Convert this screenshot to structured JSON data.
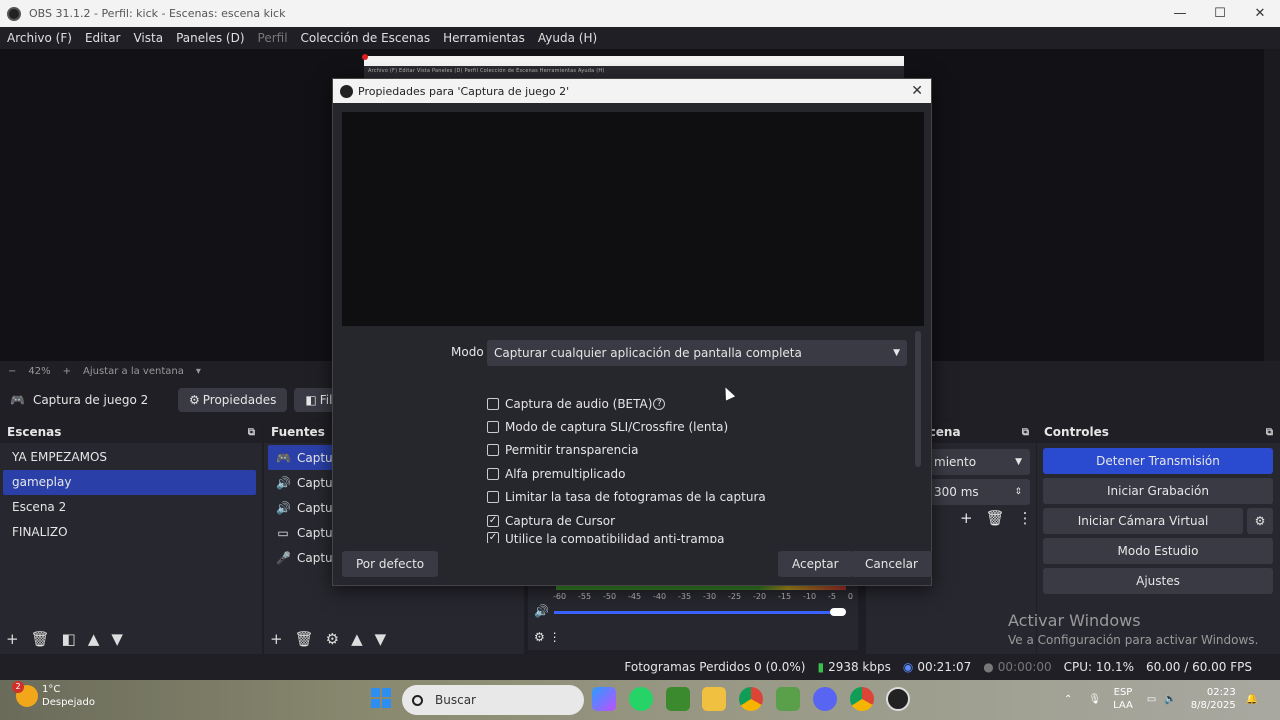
{
  "window": {
    "title": "OBS 31.1.2 - Perfil: kick - Escenas: escena kick",
    "minimize": "—",
    "maximize": "☐",
    "close": "✕"
  },
  "menu": {
    "items": [
      "Archivo (F)",
      "Editar",
      "Vista",
      "Paneles (D)",
      "Perfil",
      "Colección de Escenas",
      "Herramientas",
      "Ayuda (H)"
    ]
  },
  "preview": {
    "thumb_menu": "Archivo (F)  Editar  Vista  Paneles (D)  Perfil  Colección de Escenas  Herramientas  Ayuda (H)"
  },
  "zoom": {
    "minus": "−",
    "level": "42%",
    "plus": "+",
    "fit": "Ajustar a la ventana",
    "dropdown": "▾"
  },
  "source_toolbar": {
    "source_name": "Captura de juego 2",
    "properties_label": "Propiedades",
    "filters_label": "Filtros"
  },
  "scenes": {
    "title": "Escenas",
    "items": [
      "YA EMPEZAMOS",
      "gameplay",
      "Escena 2",
      "FINALIZO"
    ],
    "active_index": 1
  },
  "sources": {
    "title": "Fuentes",
    "items": [
      "Captura",
      "Captura",
      "Captura",
      "Captura",
      "Captura"
    ]
  },
  "transitions": {
    "title": "es de escena",
    "mode": "miento",
    "duration": "300 ms"
  },
  "controls": {
    "title": "Controles",
    "stop_stream": "Detener Transmisión",
    "start_recording": "Iniciar Grabación",
    "virtual_cam": "Iniciar Cámara Virtual",
    "studio_mode": "Modo Estudio",
    "settings": "Ajustes"
  },
  "mixer": {
    "ticks": [
      "-60",
      "-55",
      "-50",
      "-45",
      "-40",
      "-35",
      "-30",
      "-25",
      "-20",
      "-15",
      "-10",
      "-5",
      "0"
    ]
  },
  "activate": {
    "line1": "Activar Windows",
    "line2": "Ve a Configuración para activar Windows."
  },
  "status": {
    "dropped": "Fotogramas Perdidos 0 (0.0%)",
    "bitrate": "2938 kbps",
    "stream_time": "00:21:07",
    "rec_time": "00:00:00",
    "cpu": "CPU: 10.1%",
    "fps": "60.00 / 60.00 FPS"
  },
  "dialog": {
    "title": "Propiedades para 'Captura de juego 2'",
    "mode_label": "Modo",
    "mode_value": "Capturar cualquier aplicación de pantalla completa",
    "options": [
      {
        "label": "Captura de audio (BETA)",
        "checked": false,
        "help": true
      },
      {
        "label": "Modo de captura SLI/Crossfire (lenta)",
        "checked": false
      },
      {
        "label": "Permitir transparencia",
        "checked": false
      },
      {
        "label": "Alfa premultiplicado",
        "checked": false
      },
      {
        "label": "Limitar la tasa de fotogramas de la captura",
        "checked": false
      },
      {
        "label": "Captura de Cursor",
        "checked": true
      },
      {
        "label": "Utilice la compatibilidad anti-trampa",
        "checked": true
      }
    ],
    "defaults_button": "Por defecto",
    "ok_button": "Aceptar",
    "cancel_button": "Cancelar"
  },
  "taskbar": {
    "temp": "1°C",
    "weather": "Despejado",
    "badge": "2",
    "search": "Buscar",
    "lang1": "ESP",
    "lang2": "LAA",
    "time": "02:23",
    "date": "8/8/2025"
  },
  "colors": {
    "accent": "#2a40a8",
    "primary_button": "#2a4ad0",
    "panel": "#27272f",
    "background": "#1e1e24"
  }
}
